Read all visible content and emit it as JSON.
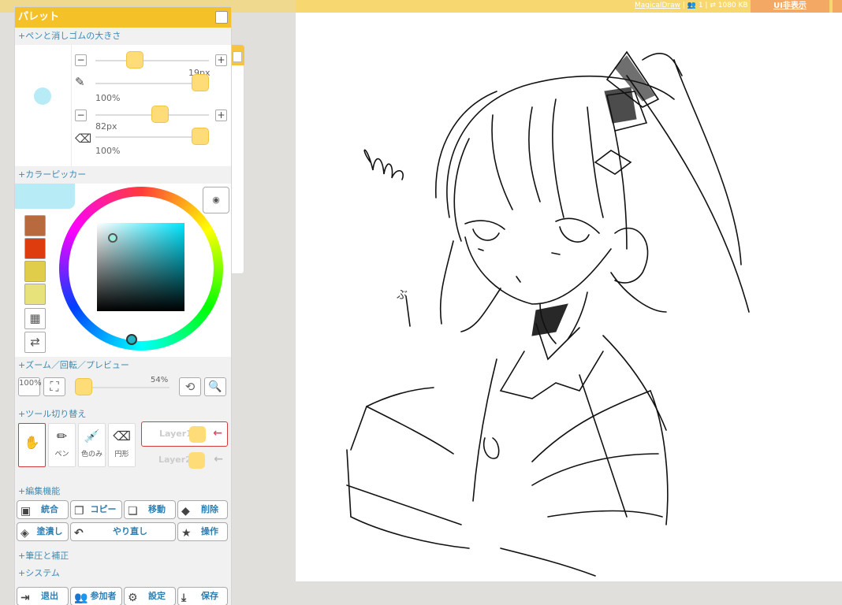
{
  "topbar": {
    "app_name": "MagicalDraw",
    "user_count": "1",
    "data_size": "1080 KB",
    "ui_toggle_label": "UI非表示"
  },
  "palette": {
    "title": "パレット",
    "sections": {
      "pen_size": "+ペンと消しゴムの大きさ",
      "color_picker": "+カラーピッカー",
      "zoom": "+ズーム／回転／プレビュー",
      "tools": "+ツール切り替え",
      "edit": "+編集機能",
      "pressure": "+筆圧と補正",
      "system": "+システム"
    },
    "pen": {
      "size": "19px",
      "opacity": "100%",
      "size_ratio": 0.32,
      "opacity_ratio": 1.0
    },
    "eraser": {
      "size": "82px",
      "opacity": "100%",
      "size_ratio": 0.58,
      "opacity_ratio": 1.0
    },
    "colors": {
      "current": "#b7ecf6",
      "swatches": [
        "#b86a3e",
        "#de3b0e",
        "#e0cd4a",
        "#e8e27a"
      ]
    },
    "zoom": {
      "reset_label": "100%",
      "value": "54%",
      "ratio": 0.0
    },
    "tools": [
      {
        "name": "hand-tool",
        "label": ""
      },
      {
        "name": "pen-tool",
        "label": "ペン"
      },
      {
        "name": "eyedropper-tool",
        "label": "色のみ"
      },
      {
        "name": "eraser-tool",
        "label": "円形"
      }
    ],
    "layers": [
      {
        "name": "Layer1",
        "active": true
      },
      {
        "name": "Layer2",
        "active": false
      }
    ],
    "edit_buttons": {
      "merge": "統合",
      "copy": "コピー",
      "move": "移動",
      "delete": "削除",
      "fill": "塗潰し",
      "redo": "やり直し",
      "action": "操作"
    },
    "system_buttons": {
      "exit": "退出",
      "participants": "参加者",
      "settings": "設定",
      "save": "保存"
    }
  },
  "canvas": {
    "annotation": "ぶ"
  }
}
